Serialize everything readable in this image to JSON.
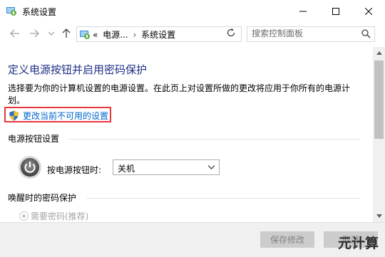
{
  "window": {
    "title": "系统设置",
    "icon": "control-panel-icon"
  },
  "nav": {
    "breadcrumbs_prefix": "«",
    "breadcrumbs": [
      "电源...",
      "系统设置"
    ],
    "search_placeholder": "搜索控制面板"
  },
  "page": {
    "title": "定义电源按钮并启用密码保护",
    "description": "选择要为你的计算机设置的电源设置。在此页上对设置所做的更改将应用于你所有的电源计划。",
    "change_link": "更改当前不可用的设置",
    "power_section_title": "电源按钮设置",
    "power_button_label": "按电源按钮时:",
    "power_button_value": "关机",
    "wake_section_title": "唤醒时的密码保护",
    "wake_option_label": "需要密码(推荐)"
  },
  "footer": {
    "save_label": "保存修改",
    "cancel_label": "取消"
  },
  "watermark": "元计算",
  "colors": {
    "title_blue": "#1e3287",
    "link_blue": "#0066cc",
    "highlight_red": "#e8363d"
  }
}
